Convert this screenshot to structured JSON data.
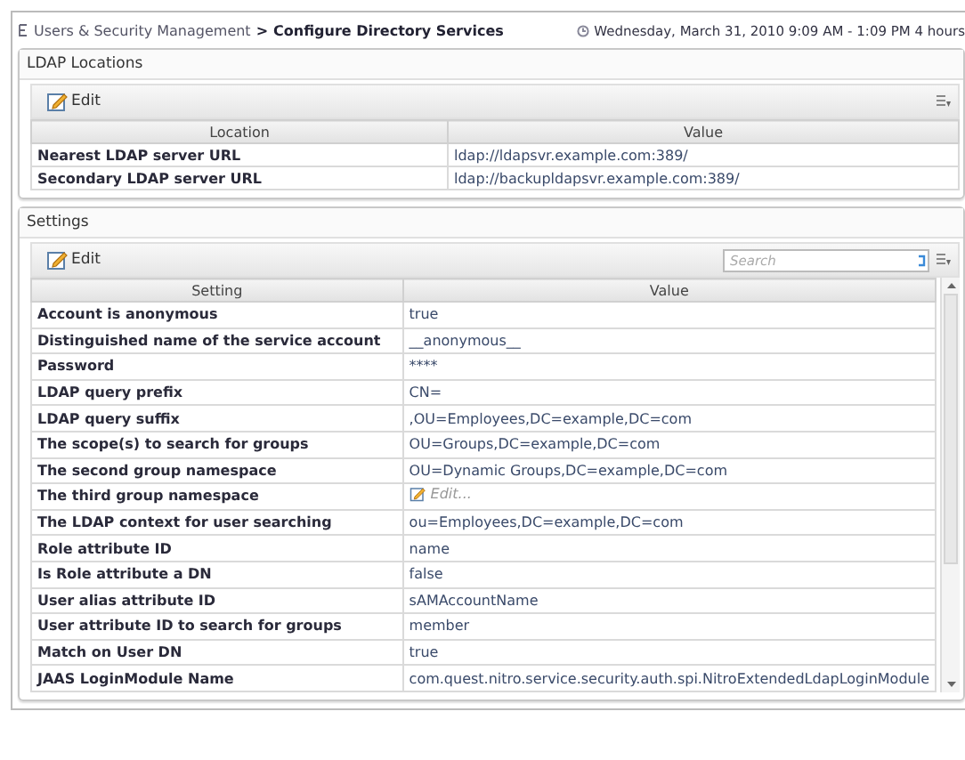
{
  "breadcrumb": {
    "parent": "Users & Security Management",
    "separator": ">",
    "current": "Configure Directory Services"
  },
  "time_range": "Wednesday, March 31, 2010 9:09 AM - 1:09 PM 4 hours",
  "panels": [
    {
      "title": "LDAP Locations",
      "toolbar": {
        "edit_button": "Edit"
      },
      "columns": [
        "Location",
        "Value"
      ],
      "rows": [
        {
          "name": "Nearest LDAP server URL",
          "value": "ldap://ldapsvr.example.com:389/",
          "kind": "text"
        },
        {
          "name": "Secondary LDAP server URL",
          "value": "ldap://backupldapsvr.example.com:389/",
          "kind": "text"
        }
      ]
    },
    {
      "title": "Settings",
      "toolbar": {
        "edit_button": "Edit",
        "search": {
          "placeholder": "Search"
        }
      },
      "columns": [
        "Setting",
        "Value"
      ],
      "rows": [
        {
          "name": "Account is anonymous",
          "value": "true",
          "kind": "text"
        },
        {
          "name": "Distinguished name of the service account",
          "value": "__anonymous__",
          "kind": "text"
        },
        {
          "name": "Password",
          "value": "****",
          "kind": "text"
        },
        {
          "name": "LDAP query prefix",
          "value": "CN=",
          "kind": "text"
        },
        {
          "name": "LDAP query suffix",
          "value": ",OU=Employees,DC=example,DC=com",
          "kind": "text"
        },
        {
          "name": "The scope(s) to search for groups",
          "value": "OU=Groups,DC=example,DC=com",
          "kind": "text"
        },
        {
          "name": "The second group namespace",
          "value": "OU=Dynamic Groups,DC=example,DC=com",
          "kind": "text"
        },
        {
          "name": "The third group namespace",
          "value": "Edit...",
          "kind": "placeholder"
        },
        {
          "name": "The LDAP context for user searching",
          "value": "ou=Employees,DC=example,DC=com",
          "kind": "text"
        },
        {
          "name": "Role attribute ID",
          "value": "name",
          "kind": "text"
        },
        {
          "name": "Is Role attribute a DN",
          "value": "false",
          "kind": "text"
        },
        {
          "name": "User alias attribute ID",
          "value": "sAMAccountName",
          "kind": "text"
        },
        {
          "name": "User attribute ID to search for groups",
          "value": "member",
          "kind": "text"
        },
        {
          "name": "Match on User DN",
          "value": "true",
          "kind": "text"
        },
        {
          "name": "JAAS LoginModule Name",
          "value": "com.quest.nitro.service.security.auth.spi.NitroExtendedLdapLoginModule",
          "kind": "text"
        }
      ]
    }
  ]
}
